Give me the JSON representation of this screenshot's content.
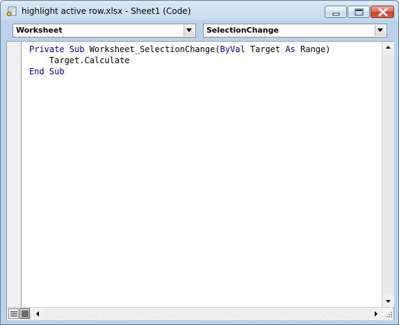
{
  "window": {
    "title": "highlight active row.xlsx - Sheet1 (Code)",
    "icons": [
      "vba-module-icon",
      "minimize-icon",
      "maximize-icon",
      "close-icon"
    ]
  },
  "selectors": {
    "object": "Worksheet",
    "procedure": "SelectionChange"
  },
  "code": {
    "lines": [
      {
        "indent": "",
        "segments": [
          {
            "text": "Private Sub ",
            "kw": true
          },
          {
            "text": "Worksheet_SelectionChange(",
            "kw": false
          },
          {
            "text": "ByVal",
            "kw": true
          },
          {
            "text": " Target ",
            "kw": false
          },
          {
            "text": "As",
            "kw": true
          },
          {
            "text": " Range)",
            "kw": false
          }
        ]
      },
      {
        "indent": "    ",
        "segments": [
          {
            "text": "Target.Calculate",
            "kw": false
          }
        ]
      },
      {
        "indent": "",
        "segments": [
          {
            "text": "End Sub",
            "kw": true
          }
        ]
      }
    ]
  },
  "colors": {
    "keyword": "#00008b",
    "text": "#000000"
  }
}
